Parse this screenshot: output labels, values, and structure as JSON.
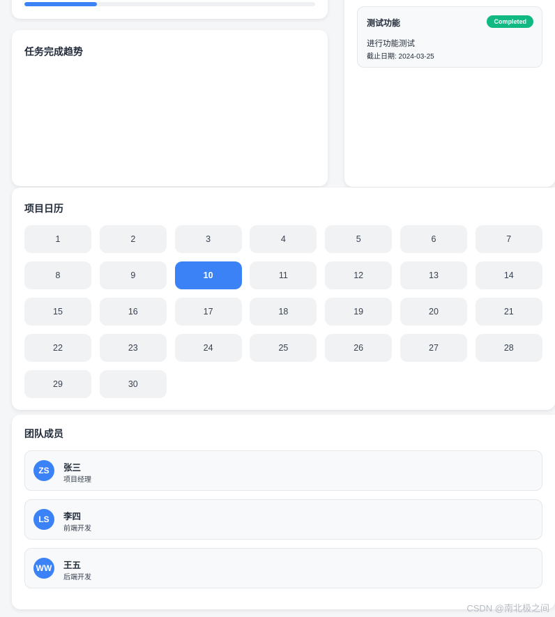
{
  "progress": {
    "value_percent": 25
  },
  "trend": {
    "title": "任务完成趋势"
  },
  "tasks": [
    {
      "name": "测试功能",
      "status": "Completed",
      "description": "进行功能测试",
      "due": "截止日期: 2024-03-25",
      "status_color": "#10b981"
    }
  ],
  "calendar": {
    "title": "项目日历",
    "selected_day": "10",
    "days": [
      "1",
      "2",
      "3",
      "4",
      "5",
      "6",
      "7",
      "8",
      "9",
      "10",
      "11",
      "12",
      "13",
      "14",
      "15",
      "16",
      "17",
      "18",
      "19",
      "20",
      "21",
      "22",
      "23",
      "24",
      "25",
      "26",
      "27",
      "28",
      "29",
      "30"
    ]
  },
  "team": {
    "title": "团队成员",
    "members": [
      {
        "initials": "ZS",
        "name": "张三",
        "role": "项目经理"
      },
      {
        "initials": "LS",
        "name": "李四",
        "role": "前端开发"
      },
      {
        "initials": "WW",
        "name": "王五",
        "role": "后端开发"
      }
    ]
  },
  "watermark": "CSDN @南北极之间",
  "colors": {
    "accent": "#3b82f6",
    "success": "#10b981"
  }
}
